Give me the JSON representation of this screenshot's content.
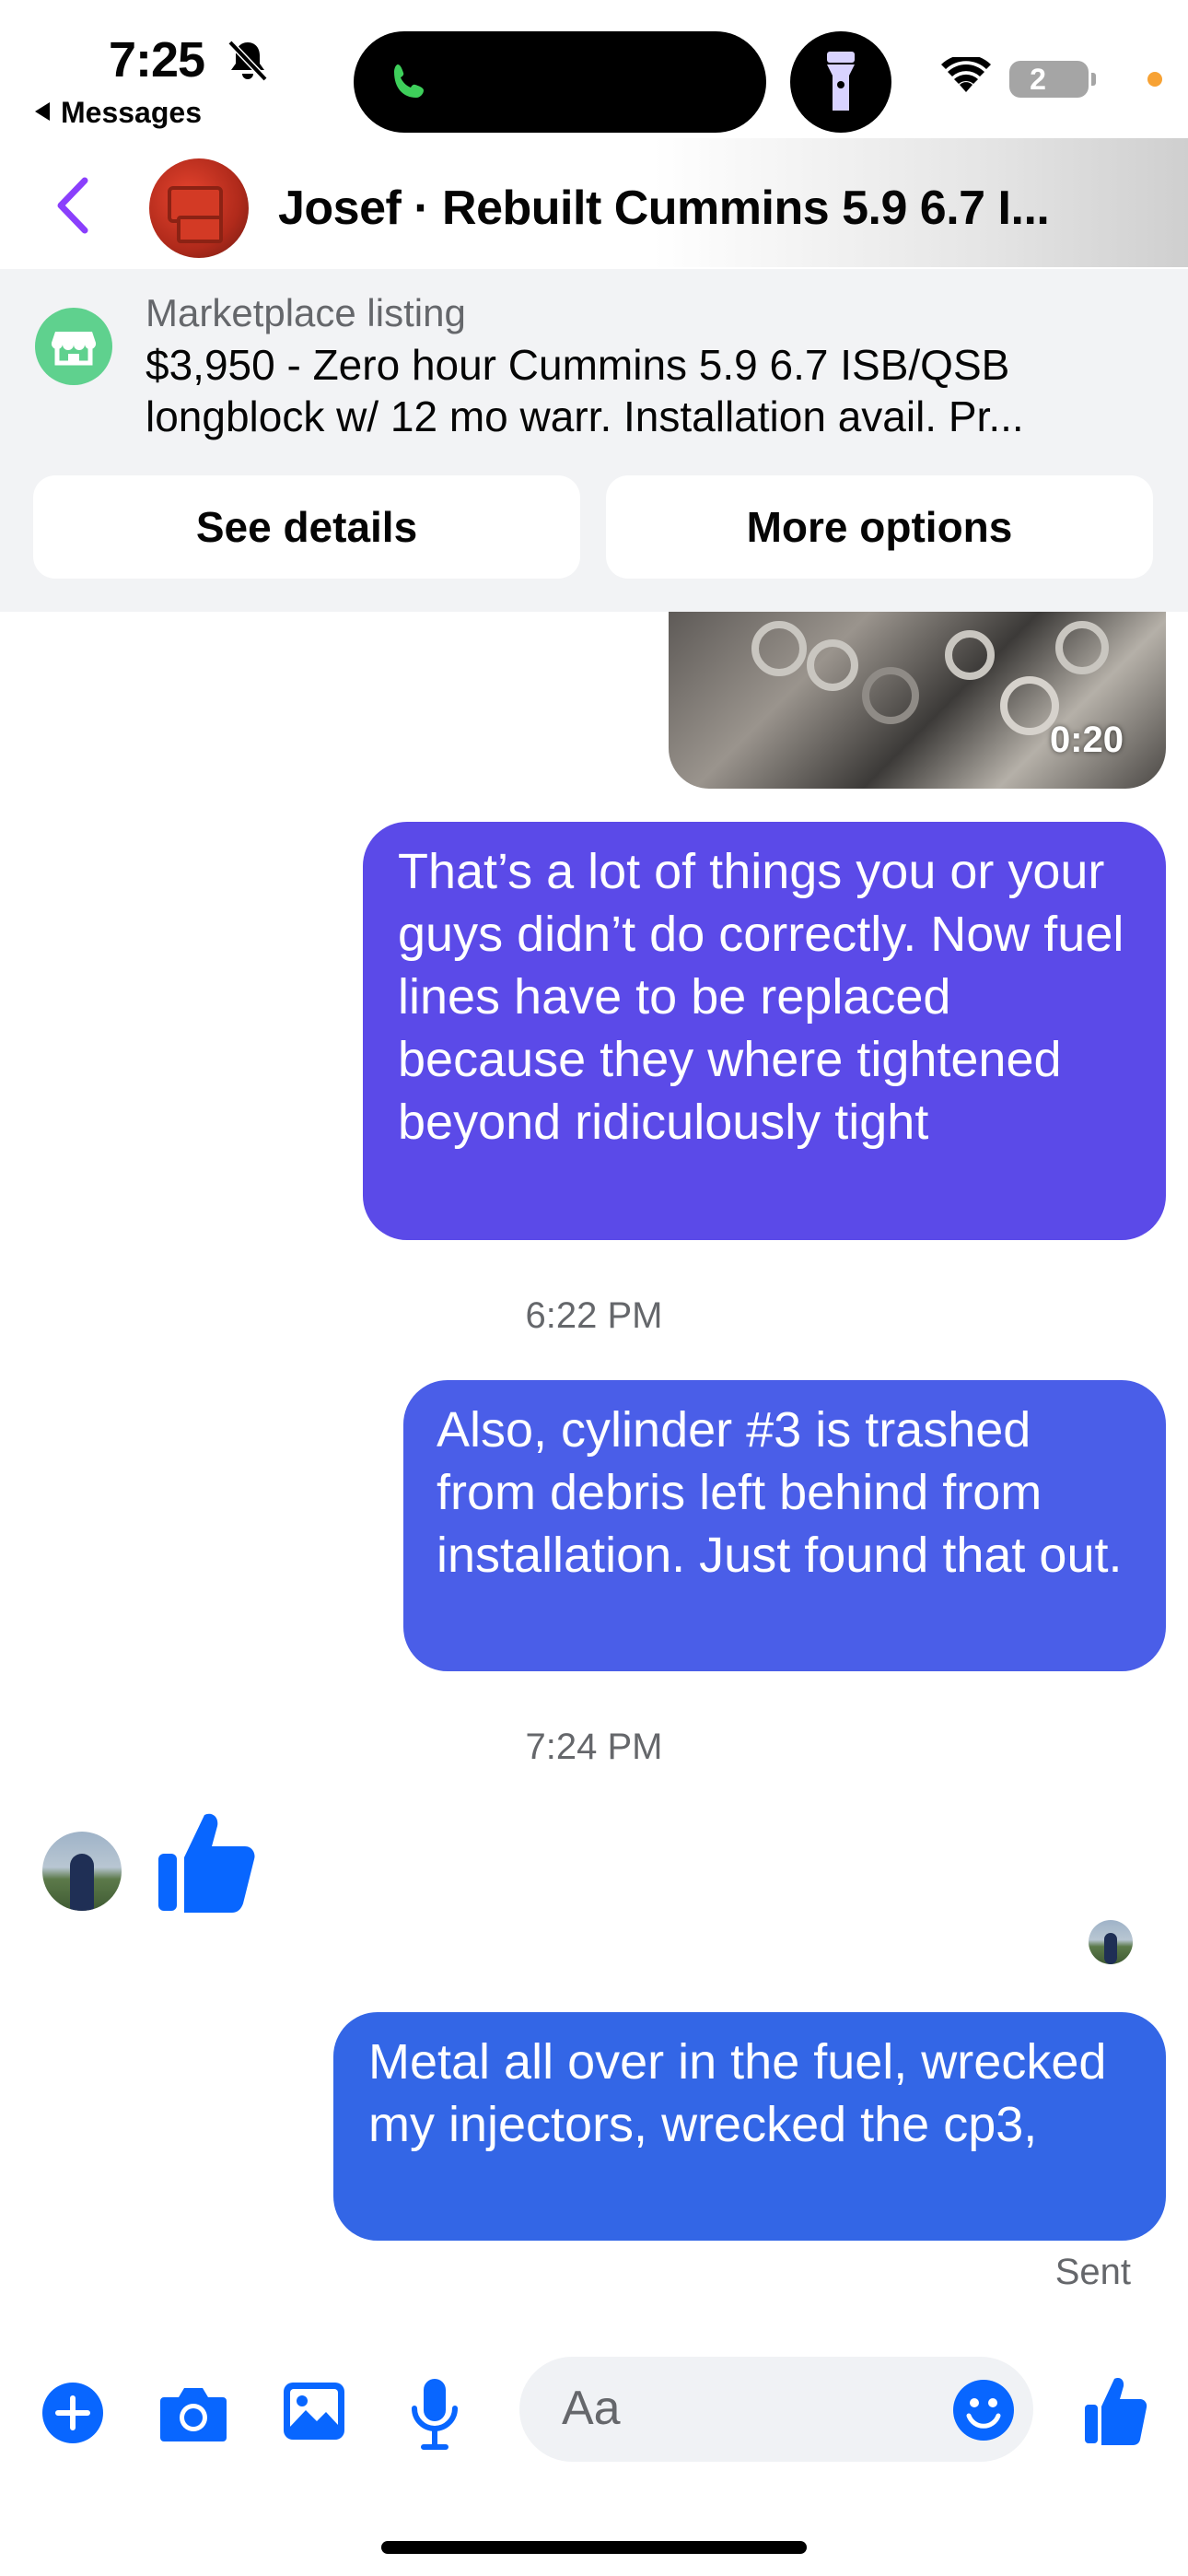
{
  "status_bar": {
    "time": "7:25",
    "back_app": "Messages",
    "battery_count": "2",
    "icons": [
      "bell-slash-icon",
      "phone-icon",
      "flashlight-icon",
      "wifi-icon",
      "battery-icon"
    ]
  },
  "header": {
    "title": "Josef · Rebuilt Cummins 5.9 6.7 I...",
    "back_icon": "chevron-left-icon"
  },
  "marketplace": {
    "label": "Marketplace listing",
    "description": "$3,950 - Zero hour Cummins 5.9 6.7 ISB/QSB longblock w/ 12 mo warr. Installation avail. Pr...",
    "see_details": "See details",
    "more_options": "More options",
    "icon": "storefront-icon"
  },
  "messages": {
    "video_duration": "0:20",
    "msg1": "That’s a lot of things you or your guys didn’t do correctly. Now fuel lines have to be replaced because they where tightened beyond ridiculously tight",
    "timestamp1": "6:22 PM",
    "msg2": "Also, cylinder #3 is trashed from debris left behind from installation. Just found that out.",
    "timestamp2": "7:24 PM",
    "reaction": "thumbs-up-icon",
    "msg3": "Metal all over in the fuel, wrecked my injectors, wrecked the cp3,",
    "sent_status": "Sent"
  },
  "composer": {
    "placeholder": "Aa",
    "icons": [
      "plus-icon",
      "camera-icon",
      "photo-icon",
      "microphone-icon",
      "emoji-icon",
      "thumbs-up-icon"
    ]
  },
  "colors": {
    "accent": "#0866ff",
    "bubble_top": "#5b4ae8",
    "bubble_mid": "#4a5ee8",
    "bubble_bottom": "#3366e6",
    "marketplace_green": "#5fd18e",
    "back_purple": "#8a3ffc"
  }
}
